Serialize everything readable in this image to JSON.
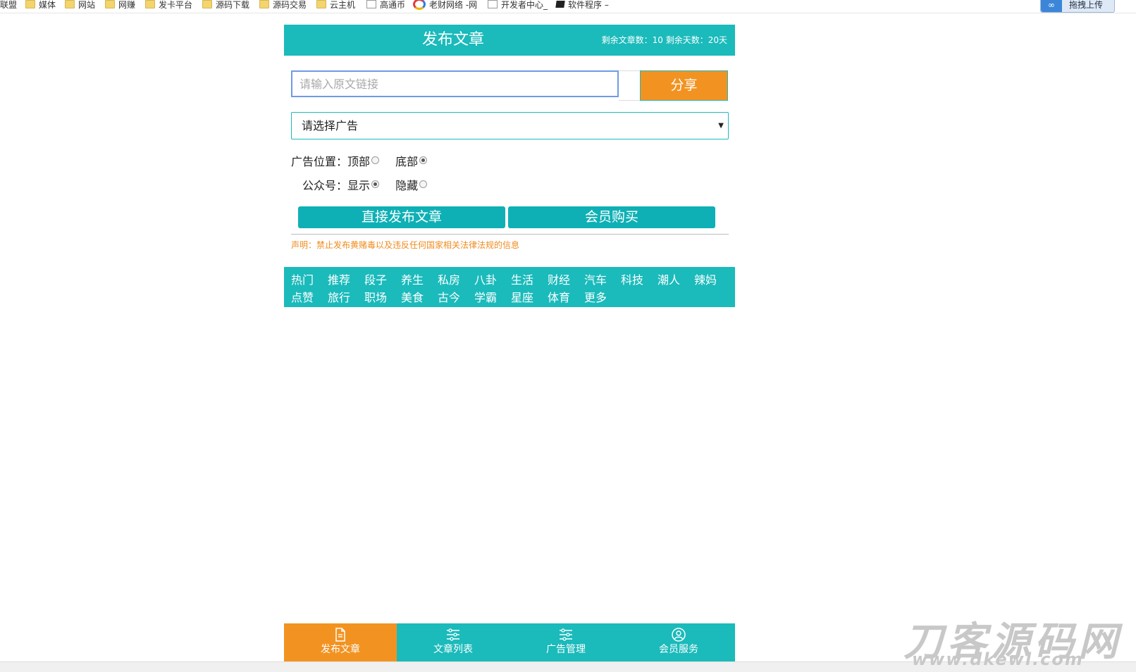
{
  "bookmarks": [
    {
      "label": "联盟",
      "icon": "none"
    },
    {
      "label": "媒体",
      "icon": "folder-icon"
    },
    {
      "label": "网站",
      "icon": "folder-icon"
    },
    {
      "label": "网赚",
      "icon": "folder-icon"
    },
    {
      "label": "发卡平台",
      "icon": "folder-icon"
    },
    {
      "label": "源码下载",
      "icon": "folder-icon"
    },
    {
      "label": "源码交易",
      "icon": "folder-icon"
    },
    {
      "label": "云主机",
      "icon": "folder-icon"
    },
    {
      "label": "高通币",
      "icon": "page-icon"
    },
    {
      "label": "老财网络 -网",
      "icon": "colorful-logo-icon"
    },
    {
      "label": "开发者中心_",
      "icon": "page-icon"
    },
    {
      "label": "软件程序 –",
      "icon": "cube-icon"
    }
  ],
  "upload_button": {
    "label": "拖拽上传",
    "logo": "∞"
  },
  "header": {
    "title": "发布文章",
    "stats": "剩余文章数：10 剩余天数：20天"
  },
  "url_input": {
    "placeholder": "请输入原文链接",
    "value": ""
  },
  "share_button": "分享",
  "ad_select": {
    "selected": "请选择广告",
    "arrow": "▼"
  },
  "ad_position": {
    "label": "广告位置：",
    "options": [
      "顶部",
      "底部"
    ],
    "selected": "底部"
  },
  "official_account": {
    "label": "公众号：",
    "options": [
      "显示",
      "隐藏"
    ],
    "selected": "显示"
  },
  "buttons": {
    "publish": "直接发布文章",
    "member_buy": "会员购买"
  },
  "notice": "声明：禁止发布黄赌毒以及违反任何国家相关法律法规的信息",
  "categories": [
    [
      "热门",
      "推荐",
      "段子",
      "养生",
      "私房",
      "八卦",
      "生活",
      "财经",
      "汽车",
      "科技",
      "潮人",
      "辣妈"
    ],
    [
      "点赞",
      "旅行",
      "职场",
      "美食",
      "古今",
      "学霸",
      "星座",
      "体育",
      "更多"
    ]
  ],
  "tabbar": [
    {
      "label": "发布文章",
      "icon": "document-icon",
      "active": true
    },
    {
      "label": "文章列表",
      "icon": "list-icon",
      "active": false
    },
    {
      "label": "广告管理",
      "icon": "list-icon",
      "active": false
    },
    {
      "label": "会员服务",
      "icon": "user-icon",
      "active": false
    }
  ],
  "watermark": {
    "line1": "刀客源码网",
    "line2": "www.dkewl.com"
  },
  "colors": {
    "teal": "#1bbabb",
    "orange": "#f29321",
    "notice": "#f08b1d",
    "button_teal": "#0fb0b5"
  }
}
